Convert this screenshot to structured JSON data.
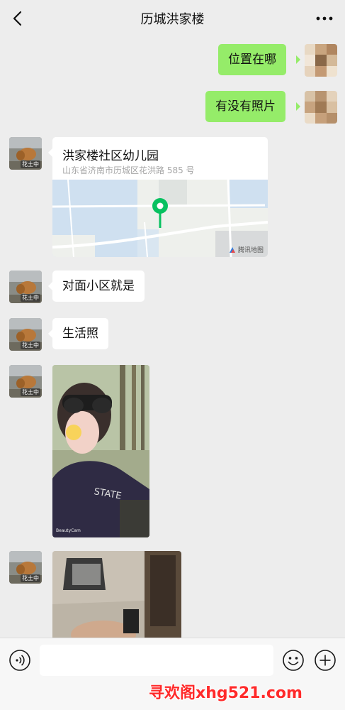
{
  "header": {
    "title": "历城洪家楼",
    "back_icon": "chevron-left-icon",
    "more_icon": "more-dots-icon"
  },
  "messages": [
    {
      "side": "right",
      "type": "text",
      "text": "位置在哪"
    },
    {
      "side": "right",
      "type": "text",
      "text": "有没有照片"
    },
    {
      "side": "left",
      "type": "location",
      "name": "洪家楼社区幼儿园",
      "address": "山东省济南市历城区花洪路 585 号",
      "map_credit": "腾讯地图"
    },
    {
      "side": "left",
      "type": "text",
      "text": "对面小区就是"
    },
    {
      "side": "left",
      "type": "text",
      "text": "生活照"
    },
    {
      "side": "left",
      "type": "image",
      "caption": "BeautyCam"
    },
    {
      "side": "left",
      "type": "image"
    }
  ],
  "avatar_badge": "花土中",
  "input_bar": {
    "placeholder": "",
    "voice_icon": "voice-icon",
    "emoji_icon": "emoji-icon",
    "plus_icon": "plus-icon"
  },
  "watermark": "寻欢阁xhg521.com",
  "colors": {
    "background": "#ededed",
    "bubble_sent": "#95ec69",
    "bubble_received": "#ffffff",
    "map_pin": "#07c160",
    "watermark": "#ff2a2a"
  }
}
